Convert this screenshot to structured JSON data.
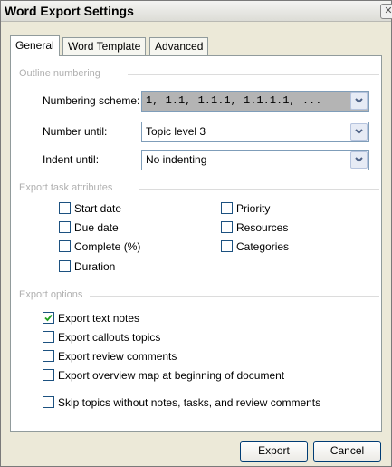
{
  "window": {
    "title": "Word Export Settings"
  },
  "tabs": [
    {
      "label": "General",
      "selected": true
    },
    {
      "label": "Word Template",
      "selected": false
    },
    {
      "label": "Advanced",
      "selected": false
    }
  ],
  "outline": {
    "heading": "Outline numbering",
    "numbering_scheme": {
      "label": "Numbering scheme:",
      "value": "1, 1.1, 1.1.1, 1.1.1.1, ..."
    },
    "number_until": {
      "label": "Number until:",
      "value": "Topic level 3"
    },
    "indent_until": {
      "label": "Indent until:",
      "value": "No indenting"
    }
  },
  "attributes": {
    "heading": "Export task attributes",
    "items": [
      {
        "label": "Start date",
        "checked": false
      },
      {
        "label": "Due date",
        "checked": false
      },
      {
        "label": "Complete (%)",
        "checked": false
      },
      {
        "label": "Duration",
        "checked": false
      },
      {
        "label": "Priority",
        "checked": false
      },
      {
        "label": "Resources",
        "checked": false
      },
      {
        "label": "Categories",
        "checked": false
      }
    ]
  },
  "options": {
    "heading": "Export options",
    "items": [
      {
        "label": "Export text notes",
        "checked": true
      },
      {
        "label": "Export callouts topics",
        "checked": false
      },
      {
        "label": "Export review comments",
        "checked": false
      },
      {
        "label": "Export overview map at beginning of document",
        "checked": false
      },
      {
        "label": "Skip topics without notes, tasks, and review comments",
        "checked": false
      }
    ]
  },
  "buttons": {
    "export": "Export",
    "cancel": "Cancel"
  },
  "icons": {
    "close": "close-icon",
    "dropdown": "chevron-down-icon",
    "check": "checkmark-icon"
  }
}
